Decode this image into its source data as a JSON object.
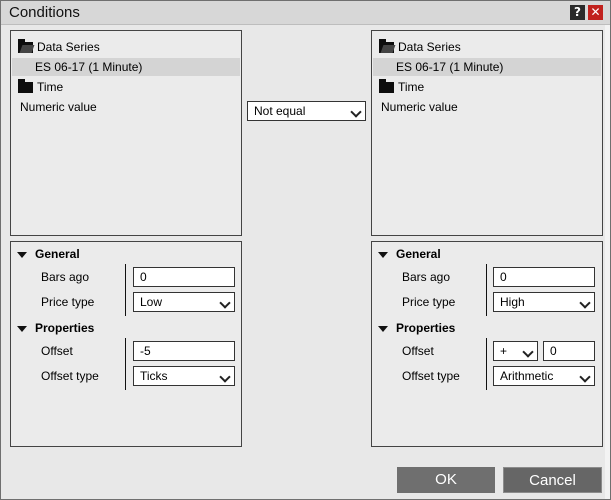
{
  "window": {
    "title": "Conditions",
    "help": "?",
    "close": "✕"
  },
  "left": {
    "tree": [
      {
        "label": "Data Series",
        "icon": "folder-open-icon"
      },
      {
        "label": "ES 06-17 (1 Minute)",
        "selected": true
      },
      {
        "label": "Time",
        "icon": "folder-icon"
      },
      {
        "label": "Numeric value"
      }
    ],
    "general": {
      "header": "General",
      "bars_ago_label": "Bars ago",
      "bars_ago_value": "0",
      "price_type_label": "Price type",
      "price_type_value": "Low"
    },
    "properties": {
      "header": "Properties",
      "offset_label": "Offset",
      "offset_value": "-5",
      "offset_type_label": "Offset type",
      "offset_type_value": "Ticks"
    }
  },
  "operator": {
    "value": "Not equal"
  },
  "right": {
    "tree": [
      {
        "label": "Data Series",
        "icon": "folder-open-icon"
      },
      {
        "label": "ES 06-17 (1 Minute)",
        "selected": true
      },
      {
        "label": "Time",
        "icon": "folder-icon"
      },
      {
        "label": "Numeric value"
      }
    ],
    "general": {
      "header": "General",
      "bars_ago_label": "Bars ago",
      "bars_ago_value": "0",
      "price_type_label": "Price type",
      "price_type_value": "High"
    },
    "properties": {
      "header": "Properties",
      "offset_label": "Offset",
      "offset_sign": "+",
      "offset_value": "0",
      "offset_type_label": "Offset type",
      "offset_type_value": "Arithmetic"
    }
  },
  "buttons": {
    "ok": "OK",
    "cancel": "Cancel"
  }
}
